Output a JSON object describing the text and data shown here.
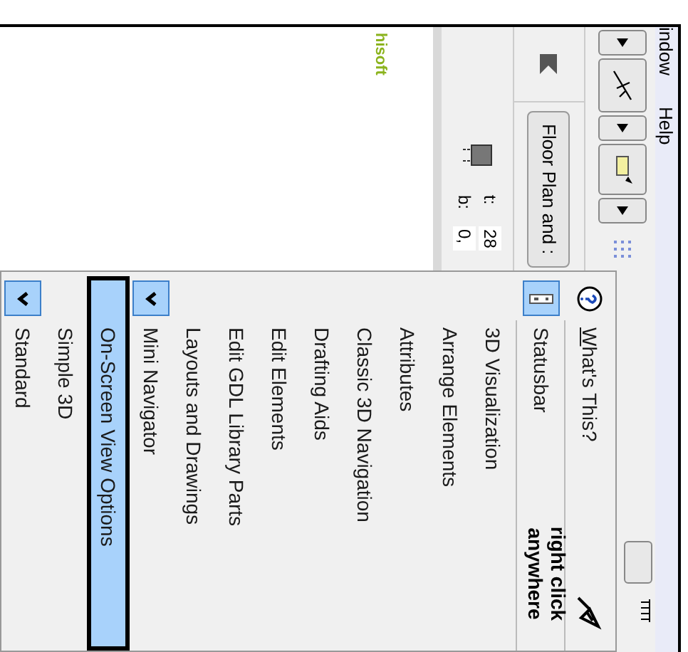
{
  "menubar": [
    {
      "label": "indow"
    },
    {
      "label": "Help"
    }
  ],
  "view_tab": {
    "label": "Floor Plan and :"
  },
  "elevation": {
    "top_label": "t:",
    "top_value": "28",
    "bottom_label": "b:",
    "bottom_value": "0,"
  },
  "canvas_text": "hisoft",
  "annotation": "right click anywhere",
  "context_menu": {
    "items": [
      {
        "kind": "help",
        "label": "What's This?",
        "checked": false,
        "selected": false
      },
      {
        "kind": "separator"
      },
      {
        "kind": "statusbar",
        "label": "Statusbar",
        "checked": true,
        "selected": false
      },
      {
        "kind": "separator"
      },
      {
        "kind": "item",
        "label": "3D Visualization",
        "checked": false,
        "selected": false
      },
      {
        "kind": "item",
        "label": "Arrange Elements",
        "checked": false,
        "selected": false
      },
      {
        "kind": "item",
        "label": "Attributes",
        "checked": false,
        "selected": false
      },
      {
        "kind": "item",
        "label": "Classic 3D Navigation",
        "checked": false,
        "selected": false
      },
      {
        "kind": "item",
        "label": "Drafting Aids",
        "checked": false,
        "selected": false
      },
      {
        "kind": "item",
        "label": "Edit Elements",
        "checked": false,
        "selected": false
      },
      {
        "kind": "item",
        "label": "Edit GDL Library Parts",
        "checked": false,
        "selected": false
      },
      {
        "kind": "item",
        "label": "Layouts and Drawings",
        "checked": false,
        "selected": false
      },
      {
        "kind": "palette",
        "label": "Mini Navigator",
        "checked": true,
        "selected": false
      },
      {
        "kind": "item",
        "label": "On-Screen View Options",
        "checked": false,
        "selected": true
      },
      {
        "kind": "item",
        "label": "Simple 3D",
        "checked": false,
        "selected": false
      },
      {
        "kind": "palette",
        "label": "Standard",
        "checked": true,
        "selected": false
      }
    ]
  }
}
